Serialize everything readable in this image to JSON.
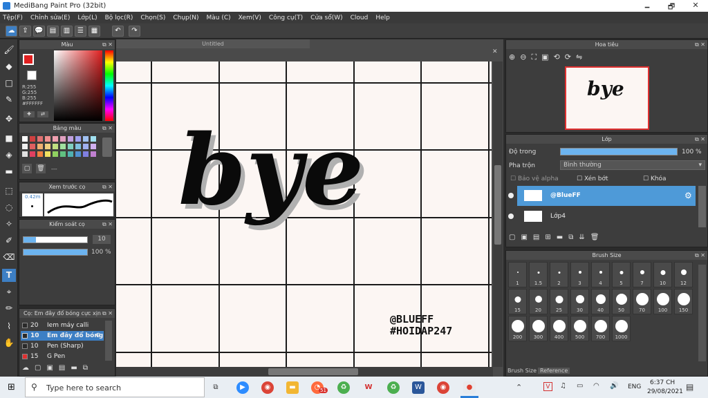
{
  "window": {
    "title": "MediBang Paint Pro (32bit)",
    "minimize": "🗕",
    "restore": "🗗",
    "close": "✕"
  },
  "menu": [
    "Tệp(F)",
    "Chỉnh sửa(E)",
    "Lớp(L)",
    "Bộ lọc(R)",
    "Chọn(S)",
    "Chụp(N)",
    "Màu (C)",
    "Xem(V)",
    "Công cụ(T)",
    "Cửa sổ(W)",
    "Cloud",
    "Help"
  ],
  "document": {
    "tab": "Untitled",
    "canvas_text": "bye",
    "signature_line1": "@BLUEFF",
    "signature_line2": "#HOIDAP247"
  },
  "color_panel": {
    "title": "Màu",
    "r": "R:255",
    "g": "G:255",
    "b": "B:255",
    "hex": "#FFFFFF"
  },
  "palette_panel": {
    "title": "Bảng màu",
    "footer": "---"
  },
  "brush_preview": {
    "title": "Xem trước cọ",
    "size": "0.42m"
  },
  "brush_control": {
    "title": "Kiểm soát cọ",
    "size_value": "10",
    "opacity_value": "100 %"
  },
  "brush_list": {
    "title": "Cọ: Em đây đổ bóng cực xịn",
    "items": [
      {
        "size": "20",
        "name": "Iem máy calli okee",
        "color": "#2a2a2a"
      },
      {
        "size": "10",
        "name": "Em đây đổ bóng",
        "color": "#2a2a2a",
        "selected": true
      },
      {
        "size": "10",
        "name": "Pen (Sharp)",
        "color": "#2a2a2a"
      },
      {
        "size": "15",
        "name": "G Pen",
        "color": "#e03030"
      }
    ]
  },
  "navigator": {
    "title": "Hoa tiêu"
  },
  "layer_panel": {
    "title": "Lớp",
    "opacity_label": "Độ trong",
    "opacity_value": "100 %",
    "blend_label": "Pha trộn",
    "blend_value": "Bình thường",
    "protect_alpha": "Bảo vệ alpha",
    "clipping": "Xén bớt",
    "lock": "Khóa",
    "layers": [
      {
        "name": "@BlueFF",
        "selected": true
      },
      {
        "name": "Lớp4",
        "selected": false
      }
    ]
  },
  "brush_size_panel": {
    "title": "Brush Size",
    "sizes": [
      "1",
      "1.5",
      "2",
      "3",
      "4",
      "5",
      "7",
      "10",
      "12",
      "15",
      "20",
      "25",
      "30",
      "40",
      "50",
      "70",
      "100",
      "150",
      "200",
      "300",
      "400",
      "500",
      "700",
      "1000"
    ],
    "tab1": "Brush Size",
    "tab2": "Reference"
  },
  "taskbar": {
    "search_placeholder": "Type here to search",
    "time": "6:37 CH",
    "date": "29/08/2021",
    "lang": "ENG",
    "badge": "51"
  }
}
